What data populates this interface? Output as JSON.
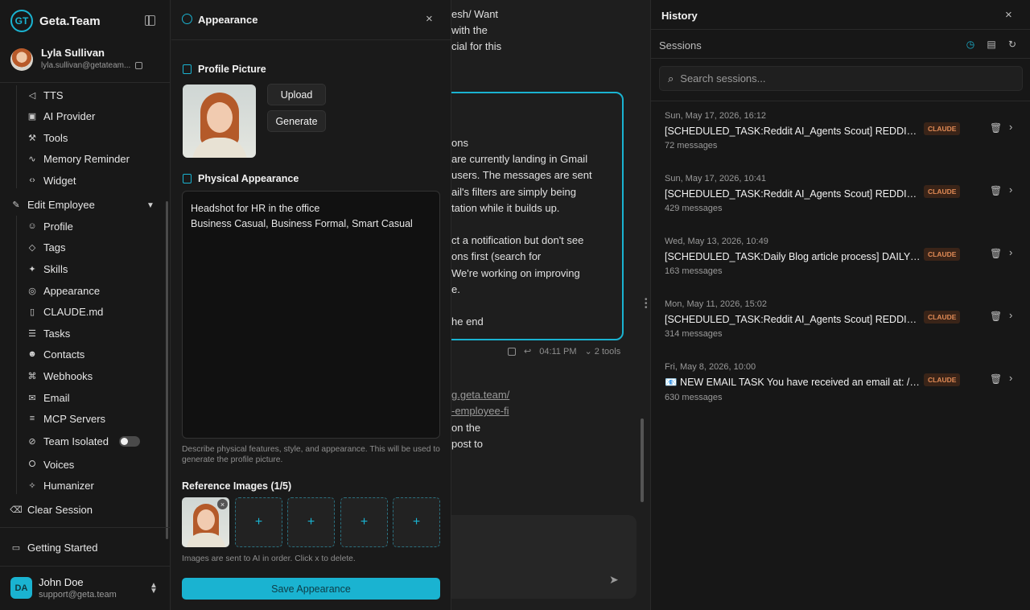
{
  "sidebar": {
    "brand": "Geta.Team",
    "brand_logo": "GT",
    "user": {
      "name": "Lyla Sullivan",
      "email": "lyla.sullivan@getateam..."
    },
    "sub_items_top": [
      {
        "label": "TTS",
        "icon": "speaker-icon",
        "glyph": "◁"
      },
      {
        "label": "AI Provider",
        "icon": "chip-icon",
        "glyph": "▣"
      },
      {
        "label": "Tools",
        "icon": "wrench-icon",
        "glyph": "⚒"
      },
      {
        "label": "Memory Reminder",
        "icon": "pulse-icon",
        "glyph": "∿"
      },
      {
        "label": "Widget",
        "icon": "code-icon",
        "glyph": "‹›"
      }
    ],
    "edit_employee": {
      "label": "Edit Employee"
    },
    "sub_items": [
      {
        "label": "Profile",
        "icon": "user-icon",
        "glyph": "☺"
      },
      {
        "label": "Tags",
        "icon": "tag-icon",
        "glyph": "◇"
      },
      {
        "label": "Skills",
        "icon": "skills-icon",
        "glyph": "✦"
      },
      {
        "label": "Appearance",
        "icon": "palette-icon",
        "glyph": "◎"
      },
      {
        "label": "CLAUDE.md",
        "icon": "file-icon",
        "glyph": "▯"
      },
      {
        "label": "Tasks",
        "icon": "list-icon",
        "glyph": "☰"
      },
      {
        "label": "Contacts",
        "icon": "contacts-icon",
        "glyph": "☻"
      },
      {
        "label": "Webhooks",
        "icon": "webhook-icon",
        "glyph": "⌘"
      },
      {
        "label": "Email",
        "icon": "mail-icon",
        "glyph": "✉"
      },
      {
        "label": "MCP Servers",
        "icon": "server-icon",
        "glyph": "≡"
      },
      {
        "label": "Team Isolated",
        "icon": "isolated-icon",
        "glyph": "⊘"
      },
      {
        "label": "Voices",
        "icon": "mic-icon",
        "glyph": "⭘"
      },
      {
        "label": "Humanizer",
        "icon": "sparkle-icon",
        "glyph": "✧"
      }
    ],
    "clear_session": "Clear Session",
    "getting_started": "Getting Started",
    "bottom_user": {
      "initials": "DA",
      "name": "John Doe",
      "email": "support@geta.team"
    }
  },
  "appearance": {
    "title": "Appearance",
    "profile_picture": "Profile Picture",
    "upload": "Upload",
    "generate": "Generate",
    "physical_appearance": "Physical Appearance",
    "description_line1": "Headshot for HR in the office",
    "description_line2": "Business Casual, Business Formal, Smart Casual",
    "help_text": "Describe physical features, style, and appearance. This will be used to generate the profile picture.",
    "reference_images": "Reference Images (1/5)",
    "ref_delete": "×",
    "ref_add": "+",
    "ref_help": "Images are sent to AI in order. Click x to delete.",
    "save": "Save Appearance"
  },
  "chat": {
    "lines_top": [
      {
        "text": "esh/ Want",
        "link": false
      },
      {
        "text": " with the",
        "link": false
      },
      {
        "text": "cial for this",
        "link": false
      }
    ],
    "bubble_lines": [
      "ons",
      "are currently landing in Gmail",
      " users. The messages are sent",
      "ail's filters are simply being",
      "tation while it builds up.",
      "",
      "ct a notification but don't see",
      "ons first (search for",
      " We're working on improving",
      "e.",
      "",
      "he end"
    ],
    "meta_time": "04:11 PM",
    "meta_tools": "2 tools",
    "lines_bottom": [
      {
        "text": "g.geta.team/",
        "link": true
      },
      {
        "text": "-employee-fi",
        "link": true
      },
      {
        "text": "on the",
        "link": false
      },
      {
        "text": " post to",
        "link": false
      }
    ]
  },
  "history": {
    "title": "History",
    "sessions_label": "Sessions",
    "search_placeholder": "Search sessions...",
    "items": [
      {
        "date": "Sun, May 17, 2026, 16:12",
        "title": "[SCHEDULED_TASK:Reddit AI_Agents Scout] REDDIT SCOUT",
        "badge": "CLAUDE",
        "count": "72 messages"
      },
      {
        "date": "Sun, May 17, 2026, 10:41",
        "title": "[SCHEDULED_TASK:Reddit AI_Agents Scout] REDDIT SCOUT",
        "badge": "CLAUDE",
        "count": "429 messages"
      },
      {
        "date": "Wed, May 13, 2026, 10:49",
        "title": "[SCHEDULED_TASK:Daily Blog article process] DAILY BLOG",
        "badge": "CLAUDE",
        "count": "163 messages"
      },
      {
        "date": "Mon, May 11, 2026, 15:02",
        "title": "[SCHEDULED_TASK:Reddit AI_Agents Scout] REDDIT SCOUT",
        "badge": "CLAUDE",
        "count": "314 messages"
      },
      {
        "date": "Fri, May 8, 2026, 10:00",
        "title": "📧 NEW EMAIL TASK You have received an email at: /opt",
        "badge": "CLAUDE",
        "count": "630 messages"
      }
    ]
  },
  "colors": {
    "accent": "#1ab3d1",
    "badge_text": "#e08a55",
    "badge_bg": "#3a2418"
  }
}
